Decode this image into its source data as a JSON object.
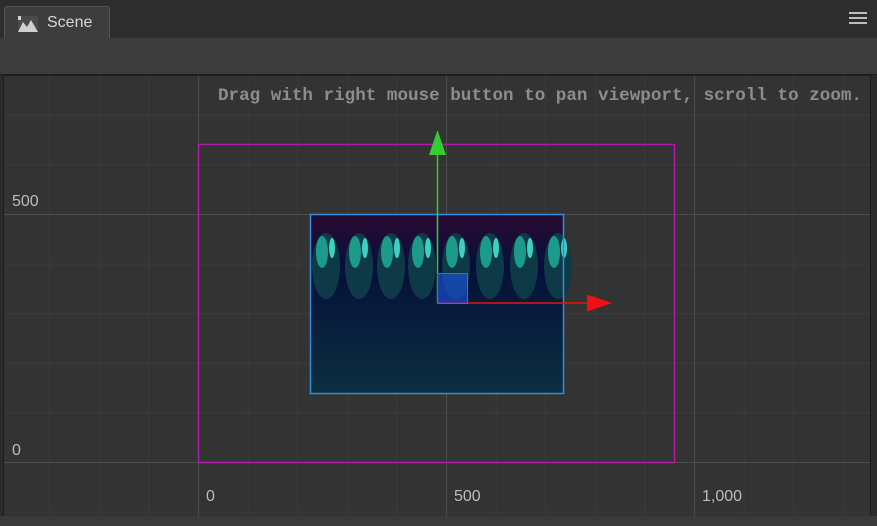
{
  "panel": {
    "tab_label": "Scene"
  },
  "icons": {
    "tab": "scene-image-icon",
    "menu": "hamburger-menu-icon"
  },
  "viewport": {
    "hint": "Drag with right mouse button to pan viewport, scroll to zoom.",
    "y_labels": [
      "500",
      "0"
    ],
    "x_labels": [
      "0",
      "500",
      "1,000"
    ]
  },
  "colors": {
    "canvas_border": "#b01ab0",
    "selection_border": "#2f8fd6",
    "gizmo_y": "#33cc33",
    "gizmo_x": "#ee1111",
    "gizmo_center": "#1d4fd8"
  }
}
